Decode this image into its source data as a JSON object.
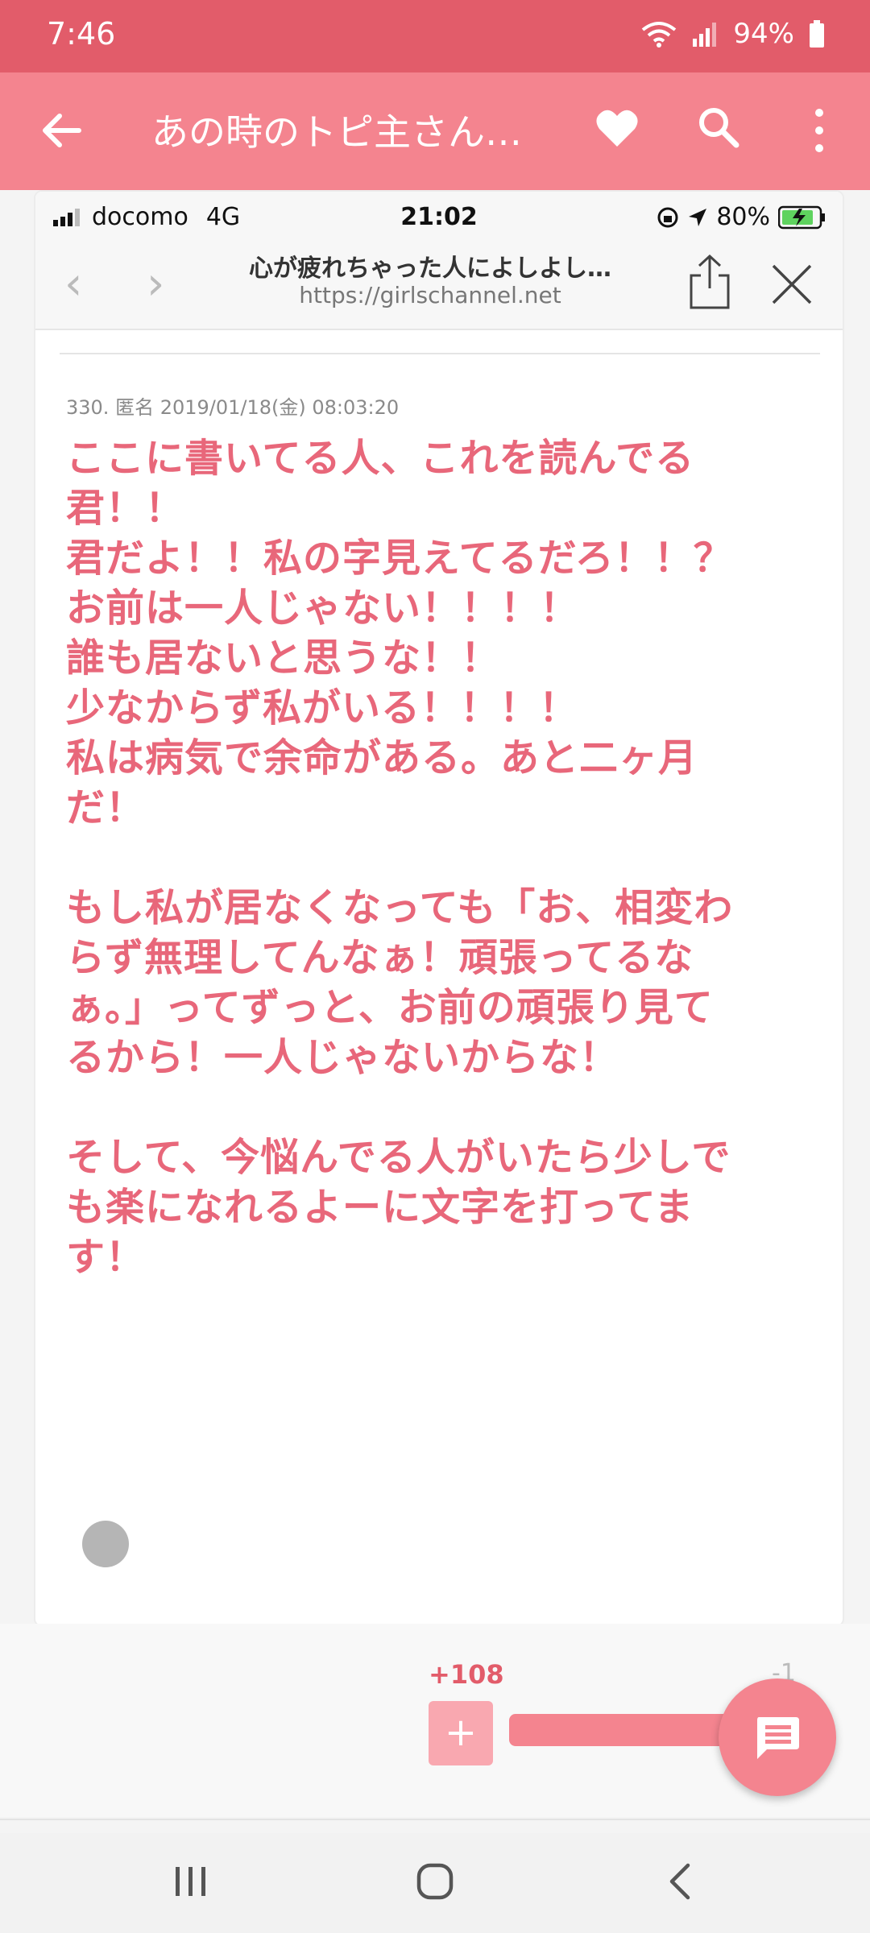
{
  "status_bar": {
    "time": "7:46",
    "battery": "94%"
  },
  "app_bar": {
    "title": "あの時のトピ主さん…"
  },
  "screenshot": {
    "carrier": "docomo",
    "network": "4G",
    "clock": "21:02",
    "battery": "80%",
    "page_title": "心が疲れちゃった人によしよし…",
    "url": "https://girlschannel.net"
  },
  "comment": {
    "meta": "330. 匿名 2019/01/18(金) 08:03:20",
    "body": "ここに書いてる人、これを読んでる\n君！！\n君だよ！！私の字見えてるだろ！！？\nお前は一人じゃない！！！！\n誰も居ないと思うな！！\n少なからず私がいる！！！！\n私は病気で余命がある。あと二ヶ月\nだ！\n\nもし私が居なくなっても「お、相変わ\nらず無理してんなぁ！頑張ってるな\nぁ。」ってずっと、お前の頑張り見て\nるから！一人じゃないからな！\n\nそして、今悩んでる人がいたら少しで\nも楽になれるよーに文字を打ってま\nす！"
  },
  "votes": {
    "plus": "+108",
    "minus": "-1",
    "plus_label": "+"
  },
  "colors": {
    "status": "#e25c6a",
    "appbar": "#f4848f",
    "text": "#e8677a"
  }
}
